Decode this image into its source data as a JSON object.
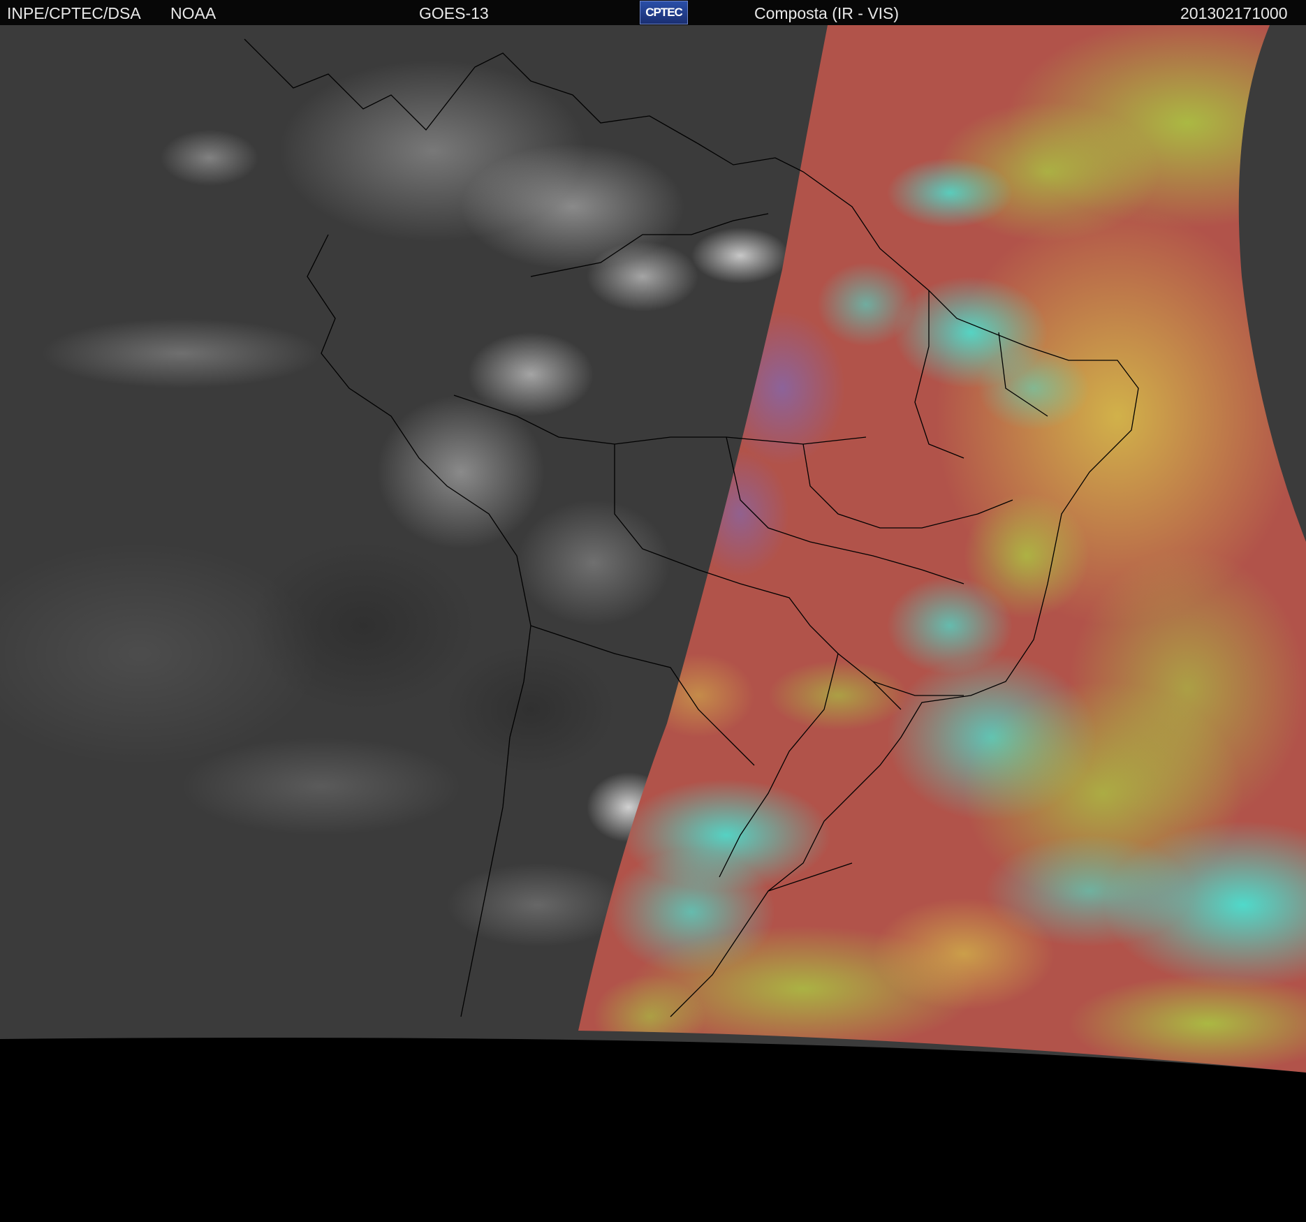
{
  "header": {
    "agency": "INPE/CPTEC/DSA",
    "provider": "NOAA",
    "satellite": "GOES-13",
    "logo_text": "CPTEC",
    "product": "Composta (IR - VIS)",
    "timestamp": "201302171000"
  },
  "colors": {
    "background": "#000000",
    "ir_gray": "#3a3a3a",
    "vis_red": "#b5504a",
    "vis_green": "#9fd04a",
    "vis_cyan": "#40ecde",
    "border_line": "#000000"
  },
  "icons": {
    "logo": "cptec-logo"
  }
}
